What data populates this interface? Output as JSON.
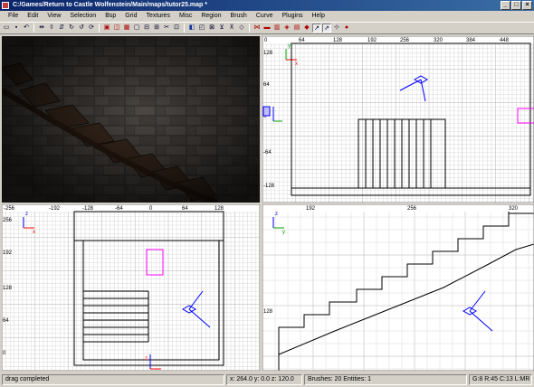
{
  "window": {
    "title": "C:/Games/Return to Castle Wolfenstein/Main/maps/tutor25.map *",
    "buttons": [
      "_",
      "□",
      "×"
    ]
  },
  "menu": [
    "File",
    "Edit",
    "View",
    "Selection",
    "Bsp",
    "Grid",
    "Textures",
    "Misc",
    "Region",
    "Brush",
    "Curve",
    "Plugins",
    "Help"
  ],
  "toolbar": {
    "icons": [
      "open-icon",
      "save-icon",
      "undo-icon",
      "flip-x-icon",
      "flip-y-icon",
      "flip-z-icon",
      "rotate-x-icon",
      "rotate-y-icon",
      "rotate-z-icon",
      "select-complete-icon",
      "select-touching-icon",
      "select-partial-icon",
      "select-inside-icon",
      "csg-subtract-icon",
      "csg-merge-icon",
      "clipper-icon",
      "hollow-icon",
      "view-change-icon",
      "cubic-clip-icon",
      "texture-lock-icon",
      "camera-movement-icon",
      "drag-edges-icon",
      "drag-vertices-icon",
      "scale-icon",
      "rotate-icon",
      "patch-icon",
      "patch-bend-icon",
      "patch-insert-icon",
      "patch-delete-icon",
      "cap-icon",
      "show-entities-icon",
      "texture-pan-icon",
      "entity-icon"
    ]
  },
  "views": {
    "xy_top": {
      "hticks": [
        "0",
        "64",
        "128",
        "192",
        "256",
        "320",
        "384",
        "448"
      ],
      "vticks": [
        "128",
        "64",
        "0",
        "-64",
        "-128"
      ],
      "axes": [
        "x",
        "y"
      ]
    },
    "xz_front": {
      "hticks": [
        "-256",
        "-192",
        "-128",
        "-64",
        "0",
        "64",
        "128"
      ],
      "vticks": [
        "256",
        "192",
        "128",
        "64",
        "0"
      ],
      "axes": [
        "x",
        "z"
      ]
    },
    "yz_side": {
      "hticks": [
        "192",
        "256",
        "320"
      ],
      "vticks": [
        "128"
      ],
      "axes": [
        "y",
        "z"
      ]
    }
  },
  "status": {
    "message": "drag completed",
    "coords": "x: 264.0  y: 0.0  z: 120.0",
    "counts": "Brushes: 20 Entities: 1",
    "grid": "G:8 R:45 C:13 L:MR"
  },
  "colors": {
    "grid_bg": "#ffffff",
    "grid_minor": "#d8d8d8",
    "grid_major": "#b0b0b0",
    "brush": "#000000",
    "selected": "#ff00ff",
    "camera": "#0000ff",
    "axis_x": "#ff0000",
    "axis_y": "#00a000",
    "axis_z": "#0000ff"
  }
}
